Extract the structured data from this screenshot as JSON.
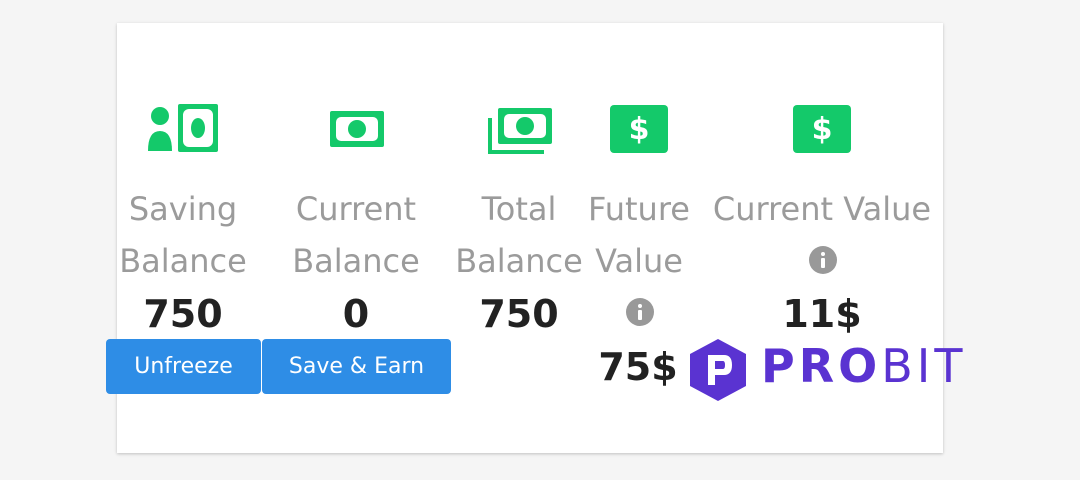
{
  "stats": {
    "saving": {
      "label_line1": "Saving",
      "label_line2": "Balance",
      "value": "750",
      "icon": "user-money-icon"
    },
    "current": {
      "label_line1": "Current",
      "label_line2": "Balance",
      "value": "0",
      "icon": "banknote-icon"
    },
    "total": {
      "label_line1": "Total",
      "label_line2": "Balance",
      "value": "750",
      "icon": "money-stack-icon"
    },
    "future": {
      "label_line1": "Future",
      "label_line2": "Value",
      "value": "75$",
      "icon": "dollar-card-icon"
    },
    "current_value": {
      "label": "Current Value",
      "value": "11$",
      "icon": "dollar-card-icon"
    }
  },
  "buttons": {
    "unfreeze": "Unfreeze",
    "save_earn": "Save & Earn"
  },
  "logo": {
    "name": "PROBIT",
    "text_bold": "PRO",
    "text_light": "BIT"
  },
  "colors": {
    "icon_green": "#14c96a",
    "button_blue": "#2e8de6",
    "label_gray": "#9b9b9b",
    "info_gray": "#999999",
    "brand_purple": "#5a33d1"
  }
}
